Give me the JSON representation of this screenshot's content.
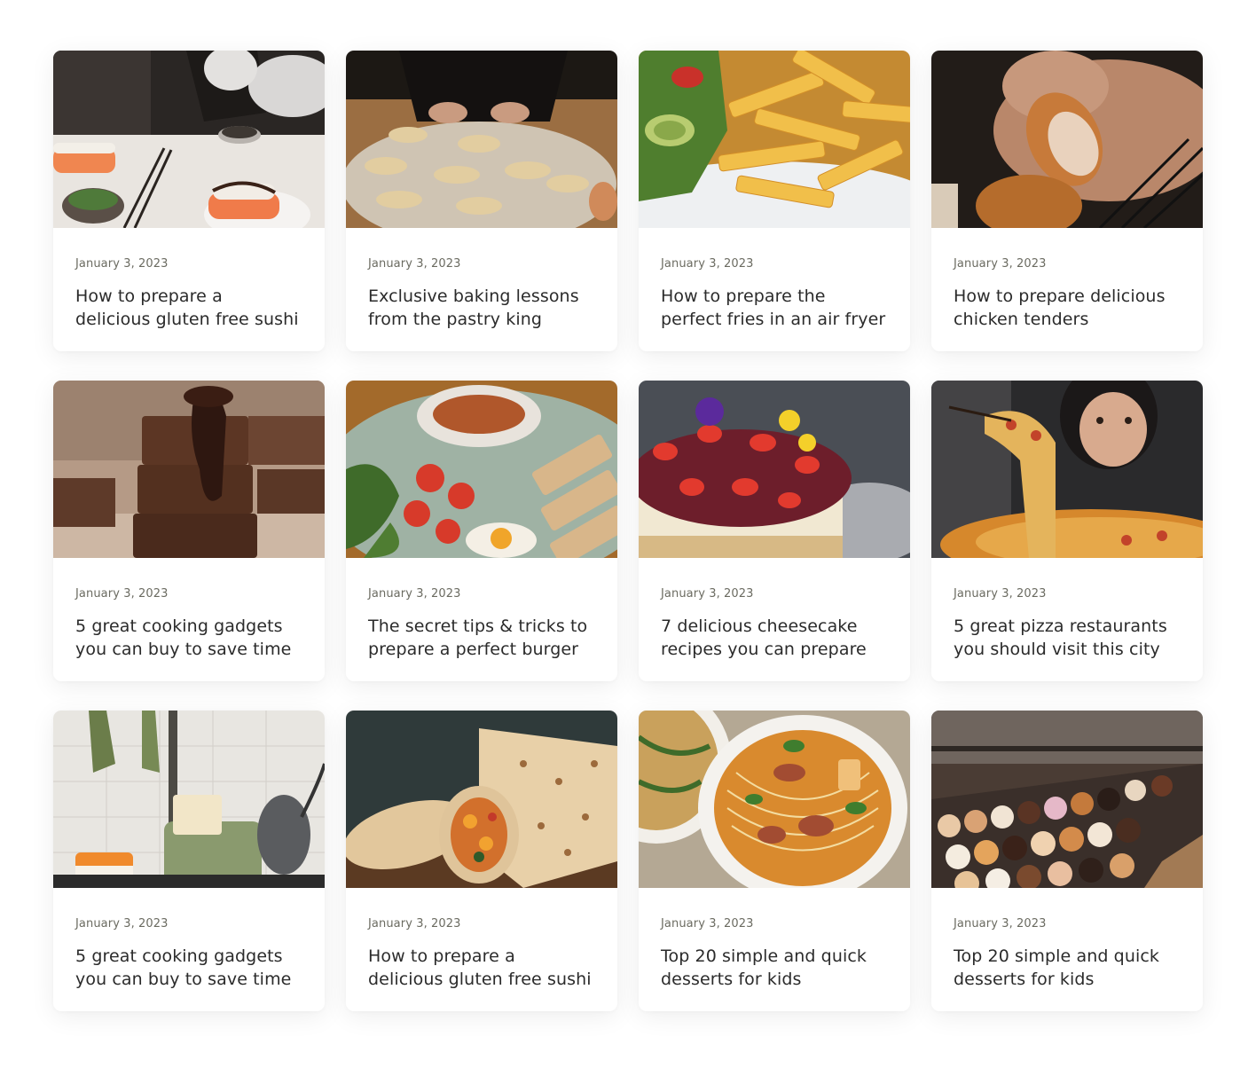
{
  "posts": [
    {
      "date": "January 3, 2023",
      "title": "How to prepare a delicious gluten free sushi",
      "image": "sushi-photo"
    },
    {
      "date": "January 3, 2023",
      "title": "Exclusive baking lessons from the pastry king",
      "image": "croissant-dough-photo"
    },
    {
      "date": "January 3, 2023",
      "title": "How to prepare the perfect fries in an air fryer",
      "image": "fries-photo"
    },
    {
      "date": "January 3, 2023",
      "title": "How to prepare delicious chicken tenders",
      "image": "chicken-tender-photo"
    },
    {
      "date": "January 3, 2023",
      "title": "5 great cooking gadgets you can buy to save time",
      "image": "brownies-photo"
    },
    {
      "date": "January 3, 2023",
      "title": "The secret tips & tricks to prepare a perfect burger",
      "image": "breakfast-plate-photo"
    },
    {
      "date": "January 3, 2023",
      "title": "7 delicious cheesecake recipes you can prepare",
      "image": "cheesecake-photo"
    },
    {
      "date": "January 3, 2023",
      "title": "5 great pizza restaurants you should visit this city",
      "image": "pizza-photo"
    },
    {
      "date": "January 3, 2023",
      "title": "5 great cooking gadgets you can buy to save time",
      "image": "toaster-kitchen-photo"
    },
    {
      "date": "January 3, 2023",
      "title": "How to prepare a delicious gluten free sushi",
      "image": "burrito-wrap-photo"
    },
    {
      "date": "January 3, 2023",
      "title": "Top 20 simple and quick desserts for kids",
      "image": "noodle-soup-photo"
    },
    {
      "date": "January 3, 2023",
      "title": "Top 20 simple and quick desserts for kids",
      "image": "pastry-display-photo"
    }
  ]
}
